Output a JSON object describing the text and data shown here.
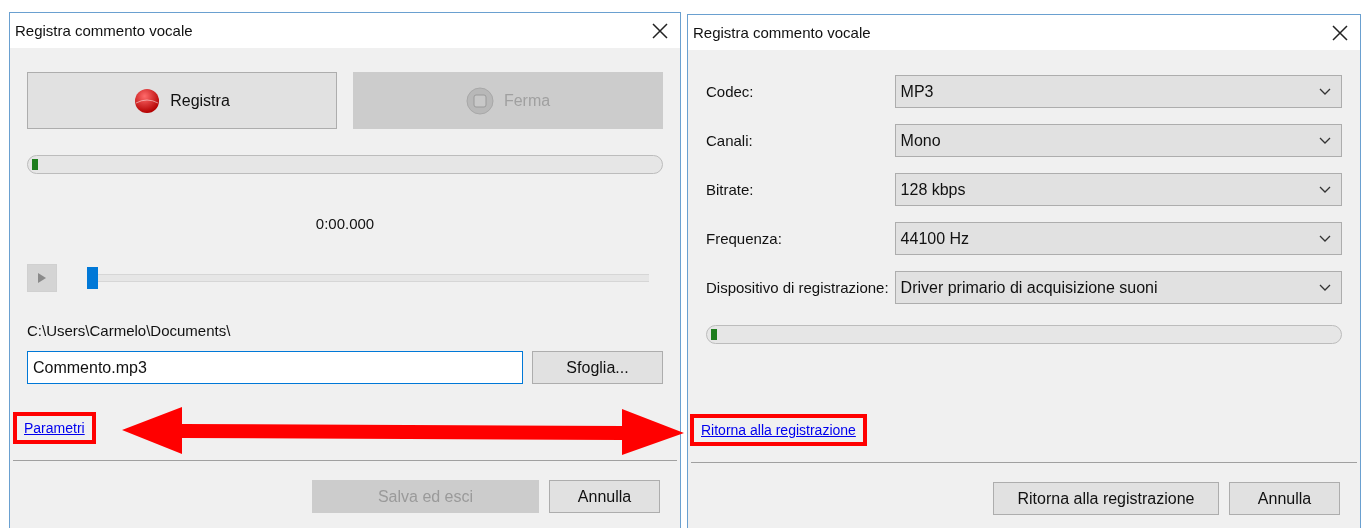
{
  "record_dialog": {
    "title": "Registra commento vocale",
    "record_button": {
      "label": "Registra",
      "disabled": false
    },
    "stop_button": {
      "label": "Ferma",
      "disabled": true
    },
    "level_meter": {
      "level": 0.01
    },
    "time": "0:00.000",
    "play_button": {
      "disabled": true
    },
    "position_slider": {
      "level": 0
    },
    "folder_path": "C:\\Users\\Carmelo\\Documents\\",
    "filename": {
      "value": "Commento.mp3"
    },
    "browse_button": {
      "label": "Sfoglia..."
    },
    "settings_link": {
      "label": "Parametri",
      "highlighted": true
    },
    "save_button": {
      "label": "Salva ed esci",
      "disabled": true
    },
    "cancel_button": {
      "label": "Annulla",
      "disabled": false
    }
  },
  "settings_dialog": {
    "title": "Registra commento vocale",
    "fields": [
      {
        "label": "Codec:",
        "value": "MP3"
      },
      {
        "label": "Canali:",
        "value": "Mono"
      },
      {
        "label": "Bitrate:",
        "value": "128 kbps"
      },
      {
        "label": "Frequenza:",
        "value": "44100 Hz"
      },
      {
        "label": "Dispositivo di registrazione:",
        "value": "Driver primario di acquisizione suoni"
      }
    ],
    "level_meter": {
      "level": 0.01
    },
    "back_link": {
      "label": "Ritorna alla registrazione",
      "highlighted": true
    },
    "back_button": {
      "label": "Ritorna alla registrazione",
      "disabled": false
    },
    "cancel_button": {
      "label": "Annulla",
      "disabled": false
    }
  }
}
